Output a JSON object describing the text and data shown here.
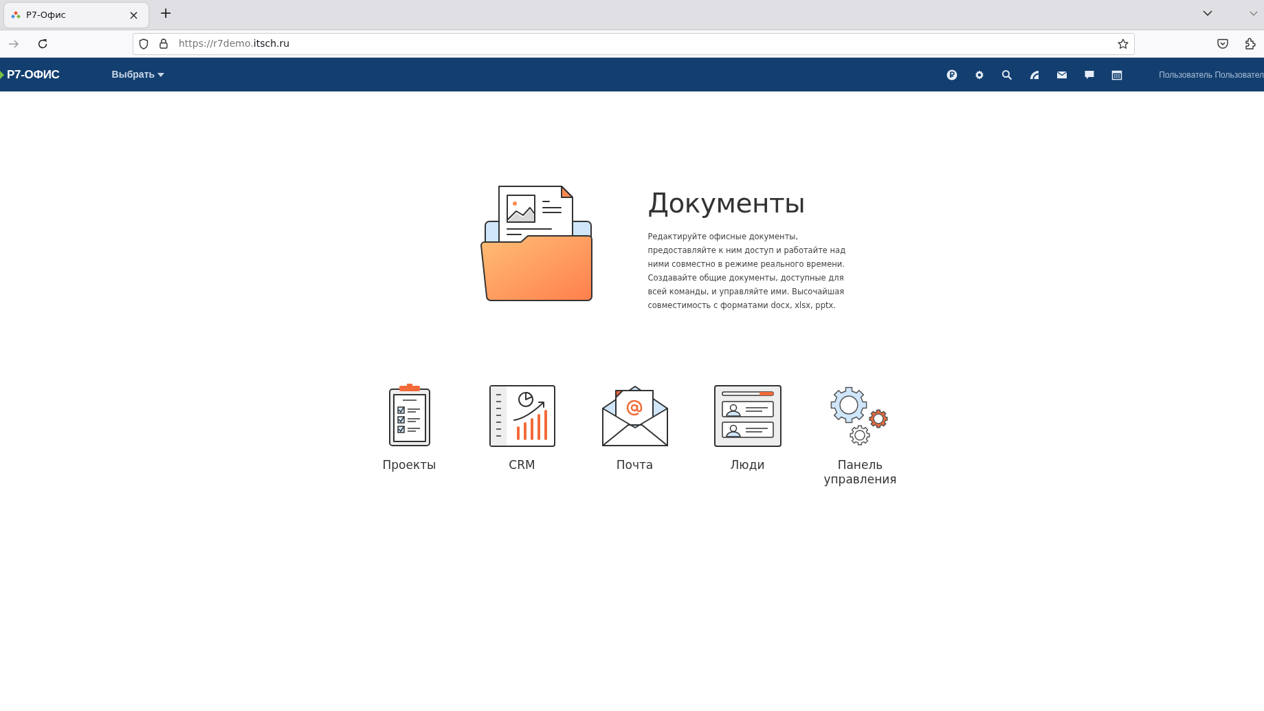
{
  "browser": {
    "tabs": [
      {
        "title": "Р7-Офис",
        "selected": true
      }
    ],
    "new_tab": "+",
    "close": "×",
    "url": {
      "prefix": "https://r7demo.",
      "domain": "itsch.ru"
    }
  },
  "navbar": {
    "logo": "Р7-ОФИС",
    "menu": "Выбрать",
    "user": "Пользователь Пользовател"
  },
  "hero": {
    "title": "Документы",
    "description": "Редактируйте офисные документы, предоставляйте к ним доступ и работайте над ними совместно в режиме реального времени. Создавайте общие документы, доступные для всей команды, и управляйте ими. Высочайшая совместимость с форматами docx, xlsx, pptx."
  },
  "modules": [
    {
      "kind": "projects",
      "label": "Проекты"
    },
    {
      "kind": "crm",
      "label": "CRM"
    },
    {
      "kind": "mail",
      "label": "Почта"
    },
    {
      "kind": "people",
      "label": "Люди"
    },
    {
      "kind": "settings",
      "label": "Панель управления"
    }
  ]
}
